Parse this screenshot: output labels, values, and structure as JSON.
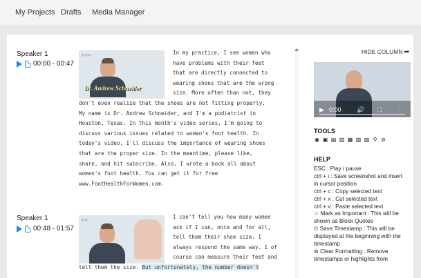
{
  "nav": {
    "projects": "My Projects",
    "drafts": "Drafts",
    "media": "Media Manager"
  },
  "segments": [
    {
      "speaker": "Speaker 1",
      "time": "00:00 - 00:47",
      "thumb_caption": "Dr. Andrew Schneider",
      "lines": [
        "In my practice, I see women who",
        "have problems with their feet",
        "that are directly connected to",
        "wearing shoes that are the wrong",
        "size. More often than not, they",
        "don't even realize that the shoes are not fitting properly.",
        "My name is Dr. Andrew Schneider, and I'm a podiatrist in",
        "Houston, Texas. In this month's video series, I'm going to",
        "discuss various issues related to women's foot health. In",
        "today's video, I'll discuss the importance of wearing shoes",
        "that are the proper size. In the meantime, please like,",
        "share, and hit subscribe. Also, I wrote a book all about",
        "women's foot health. You can get it for free",
        "www.FootHealthForWomen.com."
      ]
    },
    {
      "speaker": "Speaker 1",
      "time": "00:48 - 01:57",
      "lines": [
        "I can't tell you how many women",
        "ask if I can, once and for all,",
        "tell them their shoe size. I",
        "always respond the same way. I of",
        "course can measure their feet and"
      ],
      "last_plain": "tell them the size. ",
      "last_highlight": "But unfortunately, the number doesn't"
    }
  ],
  "side": {
    "hide_column": "HIDE COLUMN",
    "video_time": "0:00",
    "tools_title": "TOOLS",
    "help_title": "HELP",
    "help_lines": [
      "ESC : Play / pause",
      "ctrl + i : Save screenshot and insert",
      "in cursor position",
      "ctrl + c : Copy selected text",
      "ctrl + x : Cut selected text",
      "ctrl + v : Paste selected text",
      "☆ Mark as Important : This will be",
      "shown as Block Quotes",
      "⏲ Save Timestamp : This will be",
      "displayed at the beginning with the",
      "timestamp",
      "⊚ Clear Formatting : Remove",
      "timestamps or highlights from"
    ]
  },
  "icons": {
    "play": "play-icon",
    "doc": "document-icon",
    "share": "share-arrow-icon",
    "tools": [
      "record-icon",
      "image-icon",
      "save-icon",
      "file-icon",
      "print-icon",
      "screenshot-icon",
      "insert-image-icon",
      "search-icon",
      "clear-icon"
    ]
  },
  "colors": {
    "accent": "#1e88e5",
    "highlight": "#d9ecf8"
  }
}
